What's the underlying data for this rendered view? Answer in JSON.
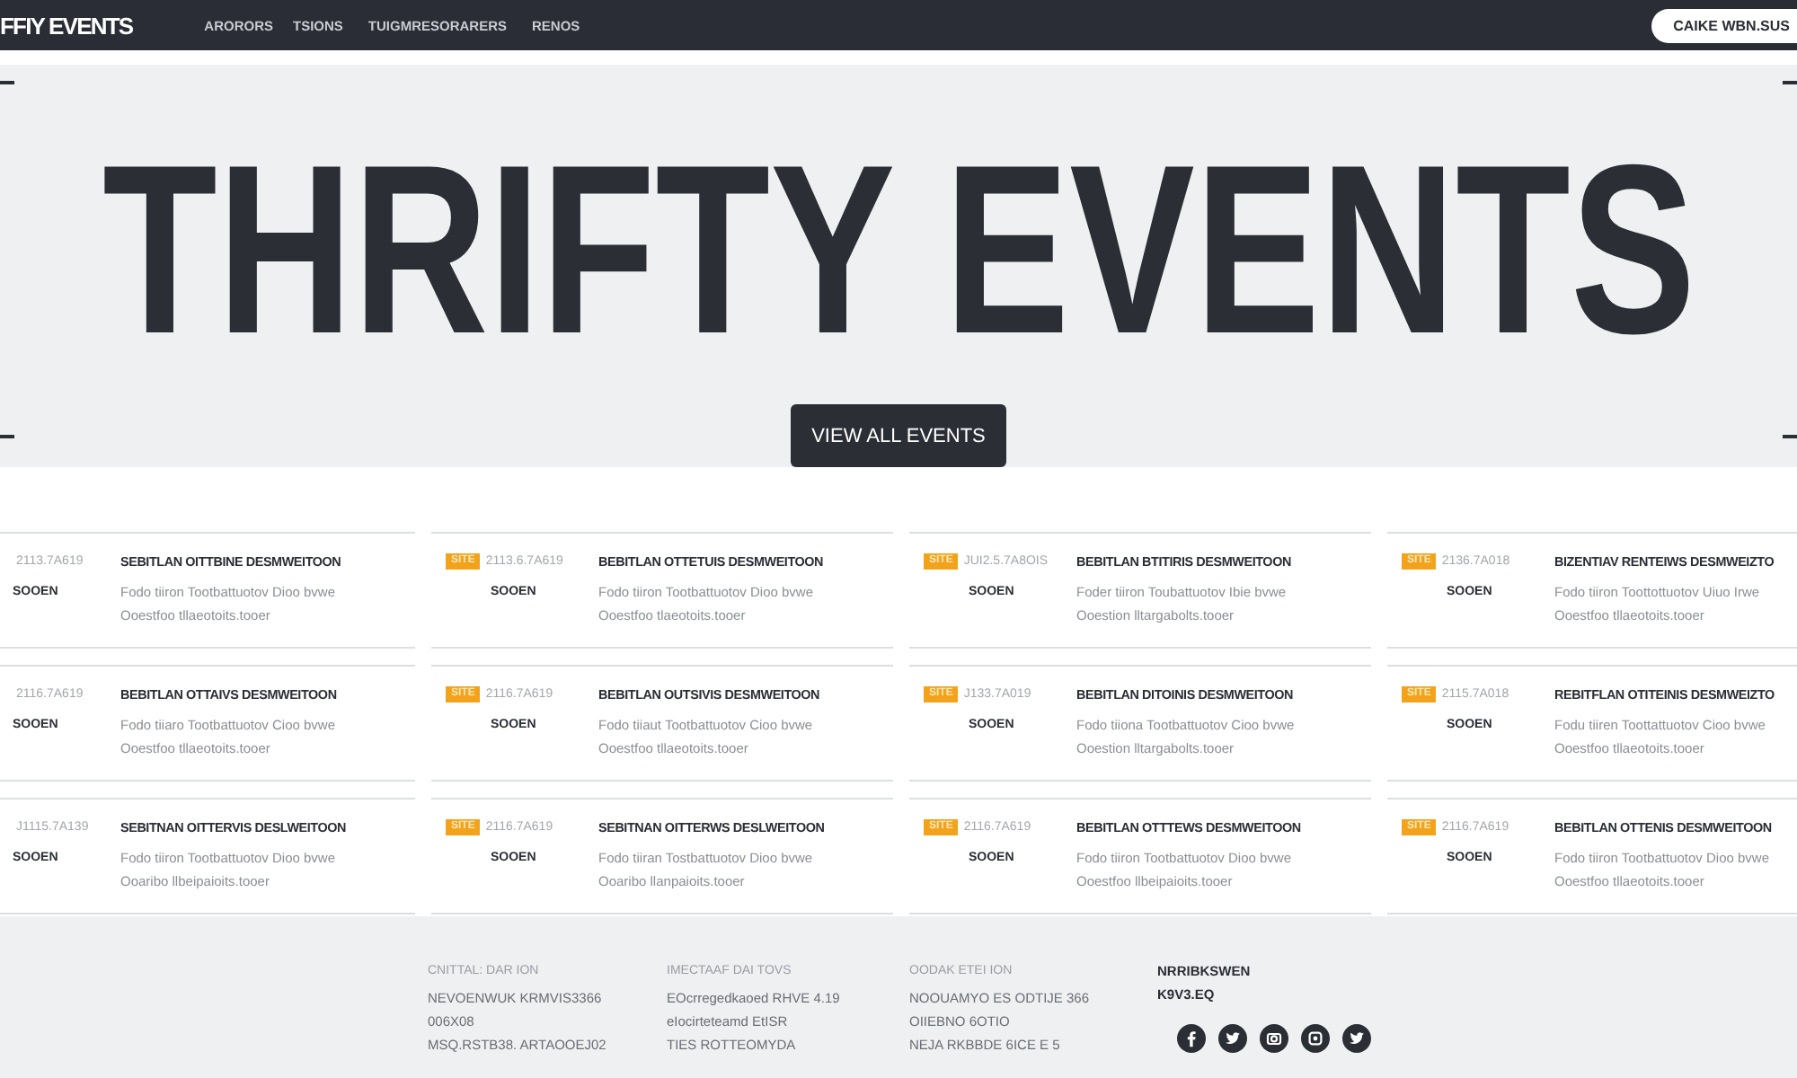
{
  "header": {
    "logo": "FFIY EVENTS",
    "nav": [
      "ARORORS",
      "TSIONS",
      "TUIGMRESORARERS",
      "RENOS"
    ],
    "button": "CAIKE WBN.SUS"
  },
  "hero": {
    "title": "THRIFTY EVENTS",
    "button": "VIEW ALL EVENTS"
  },
  "events": [
    {
      "date": "2113.7A619",
      "title": "SEBITLAN OITTBINE DESMWEITOON",
      "tag": "SOOEN",
      "description": "Fodo tiiron Tootbattuotov Dioo bvwe Ooestfoo tllaeotoits.tooer"
    },
    {
      "badge": "SITE",
      "date": "2113.6.7A619",
      "title": "BEBITLAN OTTETUIS DESMWEITOON",
      "tag": "SOOEN",
      "description": "Fodo tiiron Tootbattuotov Dioo bvwe Ooestfoo tlaeotoits.tooer"
    },
    {
      "badge": "SITE",
      "date": "JUI2.5.7A8OIS",
      "title": "BEBITLAN BTITIRIS DESMWEITOON",
      "tag": "SOOEN",
      "description": "Foder tiiron Toubattuotov Ibie bvwe Ooestion lltargabolts.tooer"
    },
    {
      "badge": "SITE",
      "date": "2136.7A018",
      "title": "BIZENTIAV RENTEIWS DESMWEIZTO",
      "tag": "SOOEN",
      "description": "Fodo tiiron Toottottuotov Uiuo Irwe Ooestfoo tllaeotoits.tooer"
    },
    {
      "date": "2116.7A619",
      "title": "BEBITLAN OTTAIVS DESMWEITOON",
      "tag": "SOOEN",
      "description": "Fodo tiiaro Tootbattuotov Cioo bvwe Ooestfoo tllaeotoits.tooer"
    },
    {
      "badge": "SITE",
      "date": "2116.7A619",
      "title": "BEBITLAN OUTSIVIS DESMWEITOON",
      "tag": "SOOEN",
      "description": "Fodo tiiaut Tootbattuotov Cioo bvwe Ooestfoo tllaeotoits.tooer"
    },
    {
      "badge": "SITE",
      "date": "J133.7A019",
      "title": "BEBITLAN DITOINIS DESMWEITOON",
      "tag": "SOOEN",
      "description": "Fodo tiiona Tootbattuotov Cioo bvwe Ooestion lltargabolts.tooer"
    },
    {
      "badge": "SITE",
      "date": "2115.7A018",
      "title": "REBITFLAN OTITEINIS DESMWEIZTO",
      "tag": "SOOEN",
      "description": "Fodu tiiren Toottattuotov Cioo bvwe Ooestfoo tllaeotoits.tooer"
    },
    {
      "date": "J1115.7A139",
      "title": "SEBITNAN OITTERVIS DESLWEITOON",
      "tag": "SOOEN",
      "description": "Fodo tiiron Tootbattuotov Dioo bvwe Ooaribo llbeipaioits.tooer"
    },
    {
      "badge": "SITE",
      "date": "2116.7A619",
      "title": "SEBITNAN OITTERWS DESLWEITOON",
      "tag": "SOOEN",
      "description": "Fodo tiiran Tostbattuotov Dioo bvwe Ooaribo llanpaioits.tooer"
    },
    {
      "badge": "SITE",
      "date": "2116.7A619",
      "title": "BEBITLAN OTTTEWS DESMWEITOON",
      "tag": "SOOEN",
      "description": "Fodo tiiron Tootbattuotov Dioo bvwe Ooestfoo llbeipaioits.tooer"
    },
    {
      "badge": "SITE",
      "date": "2116.7A619",
      "title": "BEBITLAN OTTENIS DESMWEITOON",
      "tag": "SOOEN",
      "description": "Fodo tiiron Tootbattuotov Dioo bvwe Ooestfoo tllaeotoits.tooer"
    }
  ],
  "footer": {
    "columns": [
      {
        "heading": "CNITTAL: DAR ION",
        "lines": [
          "NEVOENWUK KRMVIS3366",
          "006X08",
          "MSQ.RSTB38. ARTAOOEJ02"
        ]
      },
      {
        "heading": "IMECTAAF DAI TOVS",
        "lines": [
          "EOcrregedkaoed RHVE 4.19",
          "eIocirteteamd EtISR",
          "TIES ROTTEOMYDA"
        ]
      },
      {
        "heading": "OODAK ETEI ION",
        "lines": [
          "NOOUAMYO ES ODTIJE 366",
          "OIIEBNO 6OTIO",
          "NEJA RKBBDE 6ICE E 5"
        ]
      }
    ],
    "contact": [
      "NRRIBKSWEN",
      "K9V3.EQ"
    ]
  }
}
